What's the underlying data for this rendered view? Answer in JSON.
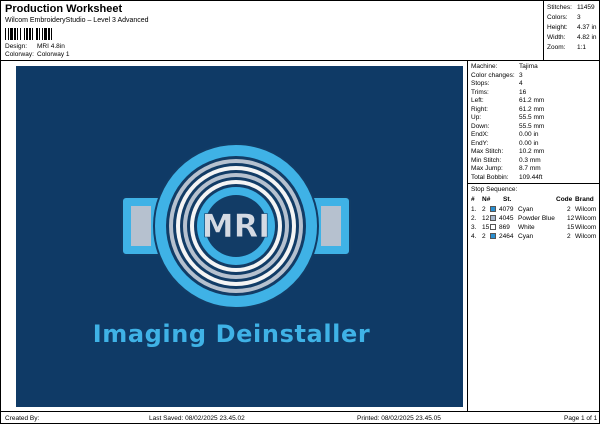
{
  "header": {
    "title": "Production Worksheet",
    "subtitle": "Wilcom EmbroideryStudio – Level 3 Advanced",
    "design_label": "Design:",
    "design_value": "MRI 4.8in",
    "colorway_label": "Colorway:",
    "colorway_value": "Colorway 1"
  },
  "summary": {
    "stitches_label": "Stitches:",
    "stitches": "11459",
    "colors_label": "Colors:",
    "colors": "3",
    "height_label": "Height:",
    "height": "4.37 in",
    "width_label": "Width:",
    "width": "4.82 in",
    "zoom_label": "Zoom:",
    "zoom": "1:1"
  },
  "design": {
    "logo_text": "MRI",
    "embroidered_text": "Imaging Deinstaller",
    "colors": {
      "background": "#0f3a66",
      "cyan": "#3fb2e6",
      "powder_blue": "#b6c1cf",
      "white": "#f4f4f4",
      "navy_stroke": "#123c66"
    }
  },
  "machine_info": [
    {
      "label": "Machine:",
      "value": "Tajima"
    },
    {
      "label": "Color changes:",
      "value": "3"
    },
    {
      "label": "Stops:",
      "value": "4"
    },
    {
      "label": "Trims:",
      "value": "16"
    },
    {
      "label": "Left:",
      "value": "61.2 mm"
    },
    {
      "label": "Right:",
      "value": "61.2 mm"
    },
    {
      "label": "Up:",
      "value": "55.5 mm"
    },
    {
      "label": "Down:",
      "value": "55.5 mm"
    },
    {
      "label": "EndX:",
      "value": "0.00 in"
    },
    {
      "label": "EndY:",
      "value": "0.00 in"
    },
    {
      "label": "Max Stitch:",
      "value": "10.2 mm"
    },
    {
      "label": "Min Stitch:",
      "value": "0.3 mm"
    },
    {
      "label": "Max Jump:",
      "value": "8.7 mm"
    },
    {
      "label": "Total Bobbin:",
      "value": "109.44ft"
    }
  ],
  "stop_sequence": {
    "title": "Stop Sequence:",
    "headers": {
      "num": "#",
      "n": "N#",
      "st": "St.",
      "name": "",
      "code": "Code",
      "brand": "Brand"
    },
    "rows": [
      {
        "num": "1.",
        "n": "2",
        "code_num": "4079",
        "name": "Cyan",
        "code": "2",
        "brand": "Wilcom",
        "color": "#2a8fd0"
      },
      {
        "num": "2.",
        "n": "12",
        "code_num": "4045",
        "name": "Powder Blue",
        "code": "12",
        "brand": "Wilcom",
        "color": "#a9b8cc"
      },
      {
        "num": "3.",
        "n": "15",
        "code_num": "869",
        "name": "White",
        "code": "15",
        "brand": "Wilcom",
        "color": "#ffffff"
      },
      {
        "num": "4.",
        "n": "2",
        "code_num": "2464",
        "name": "Cyan",
        "code": "2",
        "brand": "Wilcom",
        "color": "#2a8fd0"
      }
    ]
  },
  "footer": {
    "created_by": "Created By:",
    "last_saved": "Last Saved: 08/02/2025 23.45.02",
    "printed": "Printed: 08/02/2025 23.45.05",
    "page": "Page 1 of 1"
  }
}
